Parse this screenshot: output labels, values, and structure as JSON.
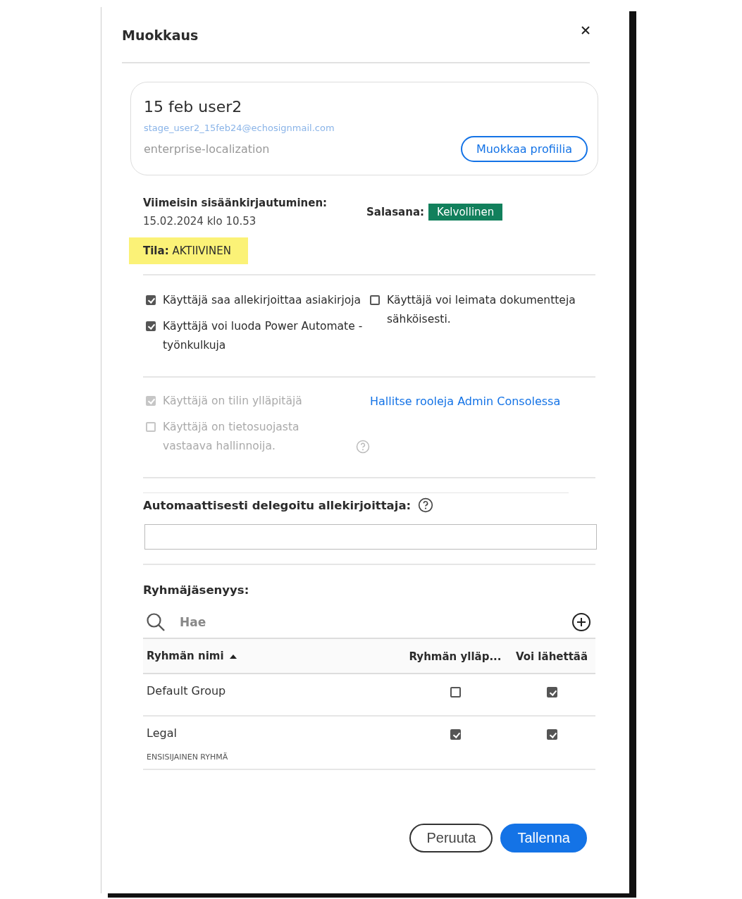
{
  "dialog": {
    "title": "Muokkaus"
  },
  "profile": {
    "name": "15 feb user2",
    "email": "stage_user2_15feb24@echosignmail.com",
    "organization": "enterprise-localization",
    "edit_button": "Muokkaa profiilia"
  },
  "last_login": {
    "label": "Viimeisin sisäänkirjautuminen:",
    "value": "15.02.2024 klo 10.53"
  },
  "password": {
    "label": "Salasana:",
    "status": "Kelvollinen"
  },
  "status": {
    "label": "Tila:",
    "value": "AKTIIVINEN"
  },
  "permissions": {
    "left": [
      {
        "label": "Käyttäjä saa allekirjoittaa asiakirjoja",
        "checked": true
      },
      {
        "label": "Käyttäjä voi luoda Power Automate -työnkulkuja",
        "checked": true
      }
    ],
    "right": [
      {
        "label": "Käyttäjä voi leimata dokumentteja sähköisesti.",
        "checked": false
      }
    ]
  },
  "roles": {
    "items": [
      {
        "label": "Käyttäjä on tilin ylläpitäjä",
        "checked": true,
        "disabled": true,
        "help": false
      },
      {
        "label": "Käyttäjä on tietosuojasta vastaava hallinnoija.",
        "checked": false,
        "disabled": true,
        "help": true
      }
    ],
    "link": "Hallitse rooleja Admin Consolessa"
  },
  "delegate": {
    "label": "Automaattisesti delegoitu allekirjoittaja:"
  },
  "groups": {
    "title": "Ryhmäjäsenyys:",
    "search_placeholder": "Hae",
    "columns": [
      "Ryhmän nimi",
      "Ryhmän ylläp...",
      "Voi lähettää"
    ],
    "rows": [
      {
        "name": "Default Group",
        "group_admin": false,
        "can_send": true
      },
      {
        "name": "Legal",
        "subtitle": "ENSISIJAINEN RYHMÄ",
        "group_admin": true,
        "can_send": true
      }
    ]
  },
  "buttons": [
    {
      "label": "Peruuta",
      "kind": "secondary"
    },
    {
      "label": "Tallenna",
      "kind": "primary"
    }
  ]
}
